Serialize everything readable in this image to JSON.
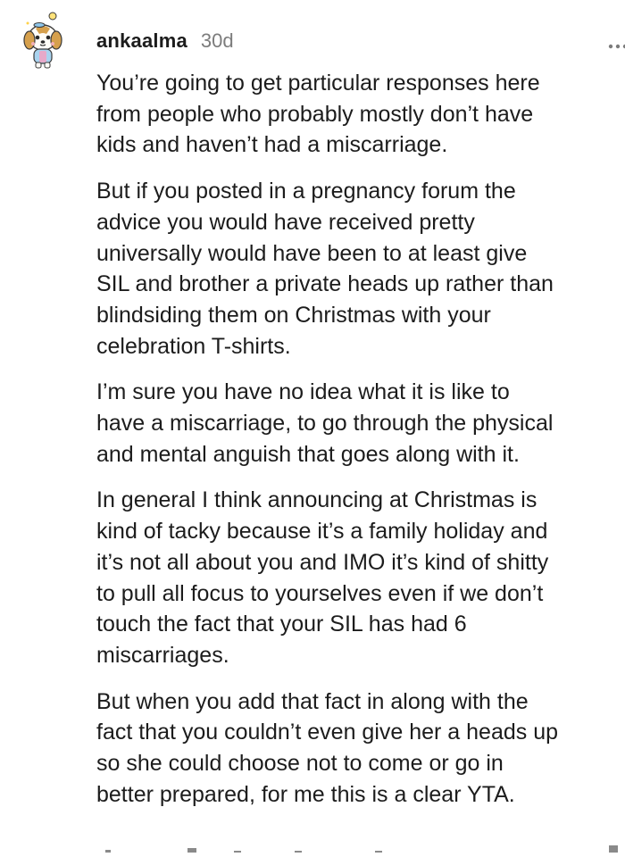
{
  "comment": {
    "author": "ankaalma",
    "age": "30d",
    "more_icon": "more-horizontal-icon",
    "avatar_icon": "dog-avatar-icon",
    "paragraphs": [
      {
        "lines": [
          "You’re going to get particular responses here",
          "from people who probably mostly don’t have",
          "kids and haven’t had a miscarriage."
        ]
      },
      {
        "lines": [
          "But if you posted in a pregnancy forum the",
          "advice you would have received pretty",
          "universally would have been to at least give",
          "SIL and brother a private heads up rather than",
          "blindsiding them on Christmas with your",
          "celebration T-shirts."
        ]
      },
      {
        "lines": [
          "I’m sure you have no idea what it is like to",
          "have a miscarriage, to go through the physical",
          "and mental anguish that goes along with it."
        ]
      },
      {
        "lines": [
          "In general I think announcing at Christmas is",
          "kind of tacky because it’s a family holiday and",
          "it’s not all about you and IMO it’s kind of shitty",
          "to pull all focus to yourselves even if we don’t",
          "touch the fact that your SIL has had 6",
          "miscarriages."
        ]
      },
      {
        "lines": [
          "But when you add that fact in along with the",
          "fact that you couldn’t even give her a heads up",
          "so she could choose not to come or go in",
          "better prepared, for me this is a clear YTA."
        ]
      }
    ]
  },
  "colors": {
    "text": "#1c1c1c",
    "muted": "#7c7c7c",
    "background": "#ffffff"
  }
}
